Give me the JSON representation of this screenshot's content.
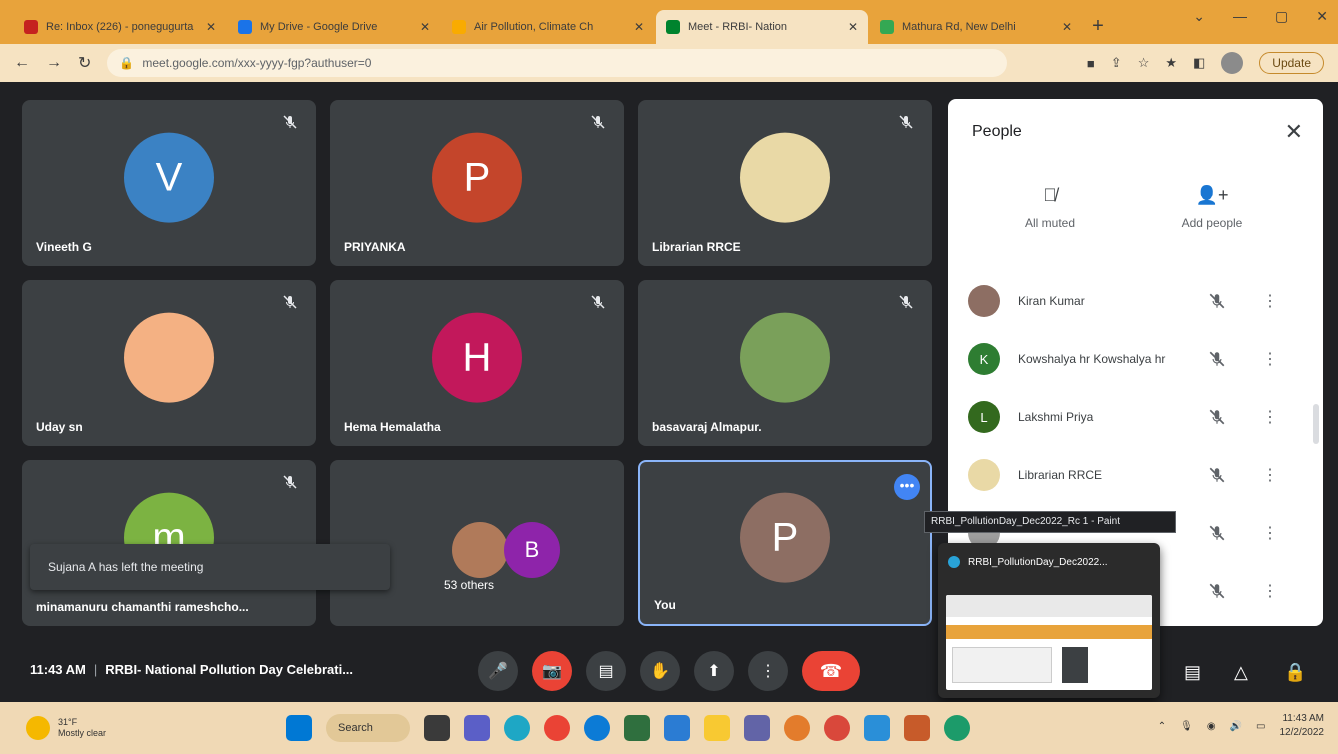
{
  "browser": {
    "tabs": [
      {
        "title": "Re: Inbox (226) - ponegugurta",
        "active": false,
        "fav_color": "#c5221f"
      },
      {
        "title": "My Drive - Google Drive",
        "active": false,
        "fav_color": "#1a73e8"
      },
      {
        "title": "Air Pollution, Climate Ch",
        "active": false,
        "fav_color": "#f9ab00"
      },
      {
        "title": "Meet - RRBI- Nation",
        "active": true,
        "fav_color": "#00832d"
      },
      {
        "title": "Mathura Rd, New Delhi",
        "active": false,
        "fav_color": "#34a853"
      }
    ],
    "url": "meet.google.com/xxx-yyyy-fgp?authuser=0",
    "update_label": "Update"
  },
  "tiles": [
    {
      "name": "Vineeth G",
      "letter": "V",
      "color": "#3b82c4"
    },
    {
      "name": "PRIYANKA",
      "letter": "P",
      "color": "#c4452b"
    },
    {
      "name": "Librarian RRCE",
      "letter": "",
      "color": "#e9d9a6"
    },
    {
      "name": "Uday sn",
      "letter": "",
      "color": "#f4b183"
    },
    {
      "name": "Hema Hemalatha",
      "letter": "H",
      "color": "#c2185b"
    },
    {
      "name": "basavaraj Almapur.",
      "letter": "",
      "color": "#7aa05a"
    },
    {
      "name": "minamanuru chamanthi rameshcho...",
      "letter": "m",
      "color": "#7cb342"
    },
    {
      "name": "53 others",
      "letter": "B",
      "color": "#8e24aa"
    },
    {
      "name": "You",
      "letter": "P",
      "color": "#8d6e63"
    }
  ],
  "toast": "Sujana A has left the meeting",
  "people_panel": {
    "title": "People",
    "all_muted": "All muted",
    "add_people": "Add people",
    "participants": [
      {
        "name": "Kiran Kumar",
        "letter": "",
        "color": "#8d6e63"
      },
      {
        "name": "Kowshalya hr Kowshalya hr",
        "letter": "K",
        "color": "#2e7d32"
      },
      {
        "name": "Lakshmi Priya",
        "letter": "L",
        "color": "#33691e"
      },
      {
        "name": "Librarian RRCE",
        "letter": "",
        "color": "#e9d9a6"
      }
    ]
  },
  "paint_tooltip": "RRBI_PollutionDay_Dec2022_Rc 1 - Paint",
  "paint_preview_title": "RRBI_PollutionDay_Dec2022...",
  "meeting": {
    "time": "11:43 AM",
    "title": "RRBI- National Pollution Day Celebrati..."
  },
  "taskbar": {
    "weather_temp": "31°F",
    "weather_desc": "Mostly clear",
    "search_label": "Search",
    "clock_time": "11:43 AM",
    "clock_date": "12/2/2022"
  }
}
